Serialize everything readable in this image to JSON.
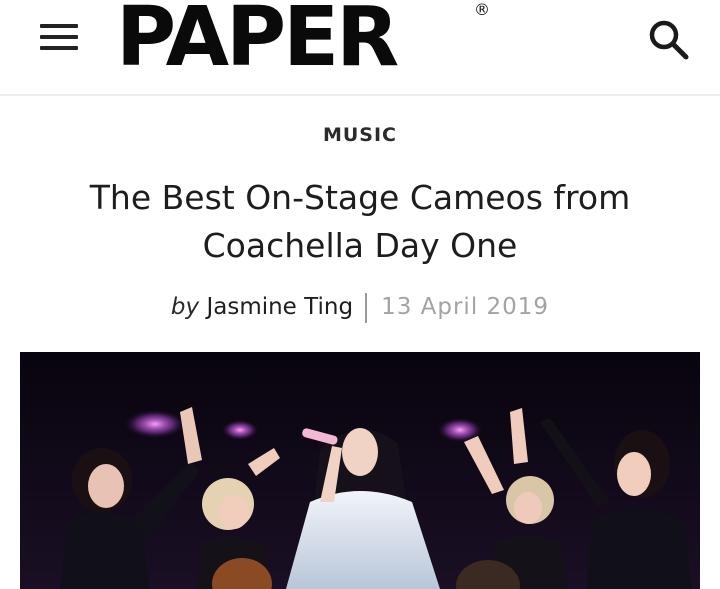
{
  "header": {
    "brand": "PAPER",
    "brand_mark": "®",
    "menu_icon": "hamburger-menu-icon",
    "search_icon": "search-icon"
  },
  "article": {
    "category": "MUSIC",
    "title": "The Best On-Stage Cameos from Coachella Day One",
    "byline_prefix": "by",
    "author": "Jasmine Ting",
    "date": "13 April 2019"
  },
  "hero_image": {
    "kind": "concert-stage-photo",
    "colors": {
      "background": "#0a0612",
      "stage_light": "#c56ad8",
      "dress": "#dfe6f0"
    }
  }
}
